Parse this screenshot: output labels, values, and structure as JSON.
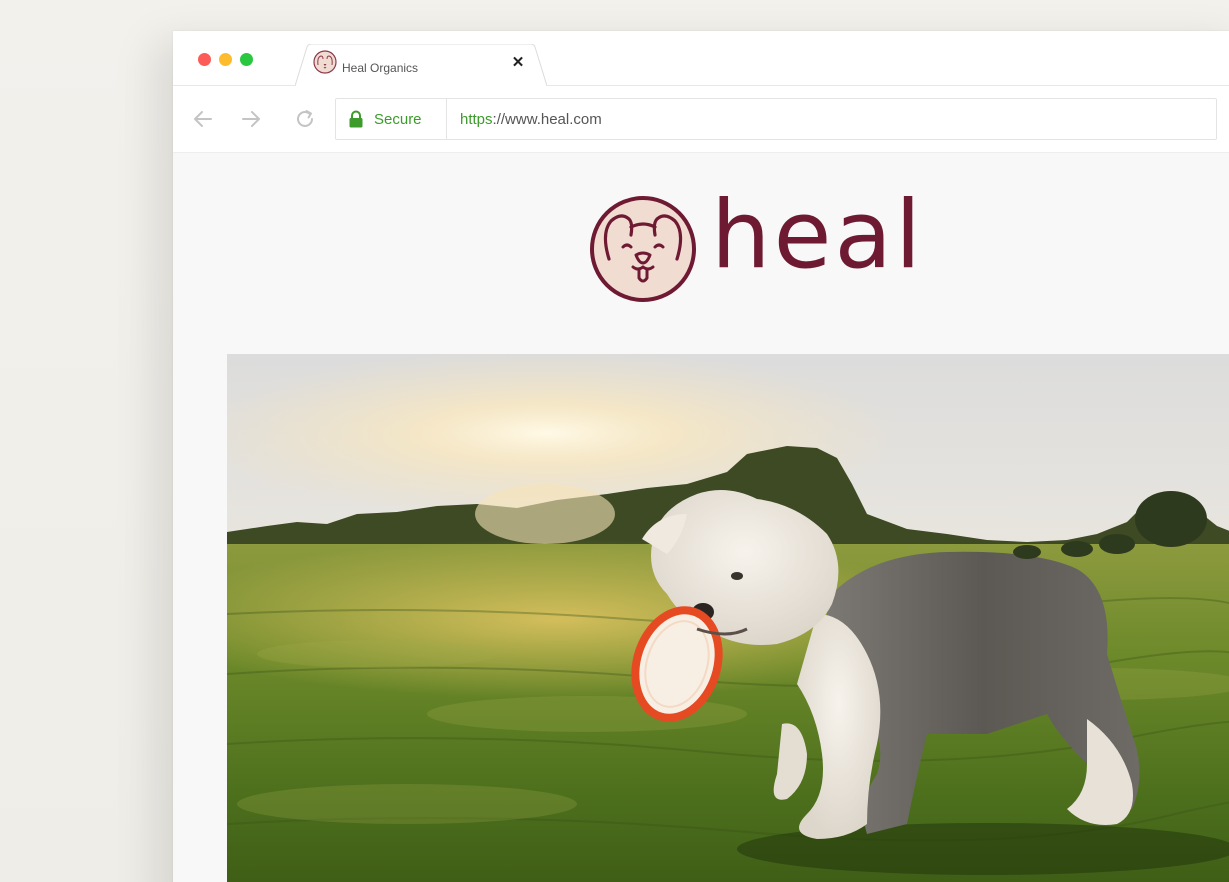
{
  "window": {
    "tab": {
      "title": "Heal Organics",
      "close_glyph": "✕",
      "favicon": "heal-dog-logo"
    }
  },
  "toolbar": {
    "back_icon": "arrow-left-icon",
    "forward_icon": "arrow-right-icon",
    "reload_icon": "reload-icon",
    "omnibox": {
      "secure_label": "Secure",
      "url_scheme": "https",
      "url_rest": "://www.heal.com"
    }
  },
  "page": {
    "logo_word": "heal",
    "hero_image": "white-and-grey-sheepdog-carrying-orange-frisbee-on-grass-field-at-sunset"
  },
  "colors": {
    "brand": "#6e1a33",
    "brand_light": "#f1dcd2",
    "secure_green": "#3c9b2b"
  }
}
